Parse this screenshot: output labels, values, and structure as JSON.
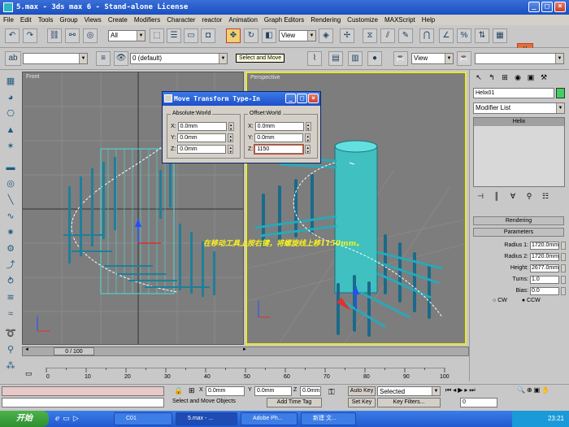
{
  "window": {
    "title": "5.max - 3ds max 6 - Stand-alone License"
  },
  "menu": [
    "File",
    "Edit",
    "Tools",
    "Group",
    "Views",
    "Create",
    "Modifiers",
    "Character",
    "reactor",
    "Animation",
    "Graph Editors",
    "Rendering",
    "Customize",
    "MAXScript",
    "Help"
  ],
  "toolbar": {
    "selection_filter": "All",
    "ref_coord": "View",
    "tooltip": "Select and Move",
    "layer": "0 (default)",
    "view_combo": "View"
  },
  "viewports": {
    "front": "Front",
    "perspective": "Perspective"
  },
  "dialog": {
    "title": "Move Transform Type-In",
    "absolute_label": "Absolute:World",
    "offset_label": "Offset:World",
    "absolute": {
      "x": "0.0mm",
      "y": "0.0mm",
      "z": "0.0mm"
    },
    "offset": {
      "x": "0.0mm",
      "y": "0.0mm",
      "z": "1150"
    },
    "axes": {
      "x": "X:",
      "y": "Y:",
      "z": "Z:"
    }
  },
  "annotation": "在移动工具上按右键，将螺旋线上移1150mm。",
  "panel": {
    "object_name": "Helix01",
    "modifier_list": "Modifier List",
    "stack_item": "Helix",
    "rendering": "Rendering",
    "parameters": "Parameters",
    "params": [
      {
        "label": "Radius 1:",
        "value": "1720.0mm"
      },
      {
        "label": "Radius 2:",
        "value": "1720.0mm"
      },
      {
        "label": "Height:",
        "value": "2677.0mm"
      },
      {
        "label": "Turns:",
        "value": "1.0"
      },
      {
        "label": "Bias:",
        "value": "0.0"
      }
    ],
    "cw": "CW",
    "ccw": "CCW"
  },
  "timeline": {
    "frame": "0 / 100",
    "ticks": [
      "0",
      "10",
      "20",
      "30",
      "40",
      "50",
      "60",
      "70",
      "80",
      "90",
      "100"
    ]
  },
  "status": {
    "x": "0.0mm",
    "y": "0.0mm",
    "z": "0.0mm",
    "auto_key": "Auto Key",
    "selected": "Selected",
    "set_key": "Set Key",
    "key_filters": "Key Filters...",
    "prompt": "Select and Move Objects",
    "add_time_tag": "Add Time Tag",
    "frame": "0",
    "xl": "X",
    "yl": "Y",
    "zl": "Z"
  },
  "taskbar": {
    "start": "开始",
    "tasks": [
      "C01",
      "5.max - ...",
      "Adobe Ph...",
      "新建 文..."
    ],
    "clock": "23:21"
  }
}
